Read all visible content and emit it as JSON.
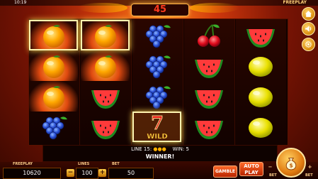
{
  "status": {
    "time": "10:19",
    "mode": "FREEPLAY"
  },
  "header": {
    "lines": "45"
  },
  "reels": [
    [
      "orange",
      "orange",
      "orange",
      "grape"
    ],
    [
      "orange",
      "orange",
      "watermelon",
      "watermelon"
    ],
    [
      "grape",
      "grape",
      "grape",
      "wild"
    ],
    [
      "cherry",
      "watermelon",
      "watermelon",
      "watermelon"
    ],
    [
      "watermelon",
      "lemon",
      "lemon",
      "lemon"
    ]
  ],
  "wild_label": "WILD",
  "info": {
    "line_label": "LINE 15:",
    "win_label": "WIN: 5",
    "message": "WINNER!"
  },
  "bottom": {
    "balance_label": "FREEPLAY",
    "balance": "10620",
    "lines_label": "LINES",
    "lines": "100",
    "bet_label": "BET",
    "bet": "50",
    "gamble": "GAMBLE",
    "autoplay": "AUTO PLAY",
    "bet_small": "BET"
  },
  "colors": {
    "accent": "#ffb347",
    "number": "#ff3b1f"
  }
}
